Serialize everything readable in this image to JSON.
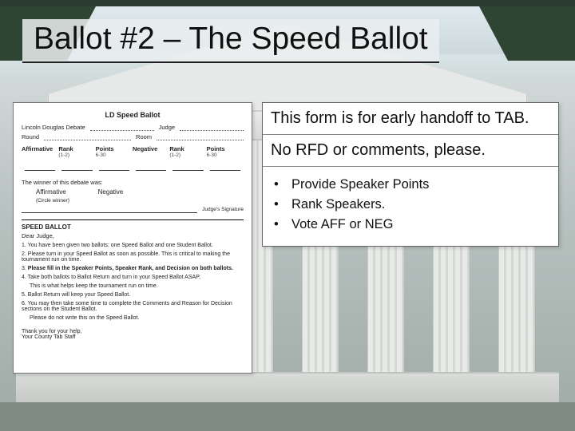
{
  "title": "Ballot #2 – The Speed Ballot",
  "info": {
    "line1": "This form is for early handoff to TAB.",
    "line2": "No RFD or comments, please.",
    "bullets": [
      "Provide Speaker Points",
      "Rank Speakers.",
      "Vote AFF or NEG"
    ]
  },
  "form": {
    "title": "LD Speed Ballot",
    "fields": {
      "division": "Lincoln Douglas Debate",
      "judge": "Judge",
      "round": "Round",
      "room": "Room"
    },
    "cols": {
      "aff": "Affirmative",
      "neg": "Negative",
      "rank": "Rank",
      "rank_sub": "(1-2)",
      "points": "Points",
      "points_sub": "6-30"
    },
    "winner_line": "The winner of this debate was:",
    "aff": "Affirmative",
    "neg": "Negative",
    "circle": "(Circle winner)",
    "sig": "Judge's Signature",
    "section": "SPEED BALLOT",
    "dear": "Dear Judge,",
    "items": [
      {
        "n": "1.",
        "t": "You have been given two ballots: one Speed Ballot and one Student Ballot."
      },
      {
        "n": "2.",
        "t": "Please turn in your Speed Ballot as soon as possible. This is critical to making the tournament run on time."
      },
      {
        "n": "3.",
        "t": "Please fill in the Speaker Points, Speaker Rank, and Decision on both ballots.",
        "bold": true
      },
      {
        "n": "4.",
        "t": "Take both ballots to Ballot Return and turn in your Speed Ballot ASAP."
      },
      {
        "n": "",
        "t": "This is what helps keep the tournament run on time."
      },
      {
        "n": "5.",
        "t": "Ballot Return will keep your Speed Ballot."
      },
      {
        "n": "6.",
        "t": "You may then take some time to complete the Comments and Reason for Decision sections on the Student Ballot."
      },
      {
        "n": "",
        "t": "Please do not write this on the Speed Ballot."
      }
    ],
    "thanks1": "Thank you for your help,",
    "thanks2": "Your County Tab Staff"
  }
}
